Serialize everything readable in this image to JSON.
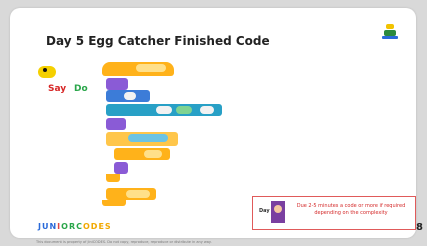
{
  "slide": {
    "title": "Day 5 Egg Catcher Finished Code",
    "sprite": {
      "say_label": "Say",
      "do_label": "Do"
    },
    "info_box": {
      "tag": "Day",
      "text": "Due 2-5 minutes a code or more if required depending on the complexity"
    },
    "brand": {
      "part1": "JUN",
      "part2": "I",
      "part3": "ORC",
      "part4": "ODES"
    },
    "footer_text": "This document is property of JiniCODES. Do not copy, reproduce, reproduce or distribute in any way.",
    "page_number": "8"
  },
  "colors": {
    "events": "#ffb21a",
    "looks": "#8a5bd6",
    "motion": "#3c7cd8",
    "sensing": "#28a0c6",
    "operators": "#34b24a",
    "info_border": "#e05a5a",
    "info_text": "#d42a2a"
  }
}
